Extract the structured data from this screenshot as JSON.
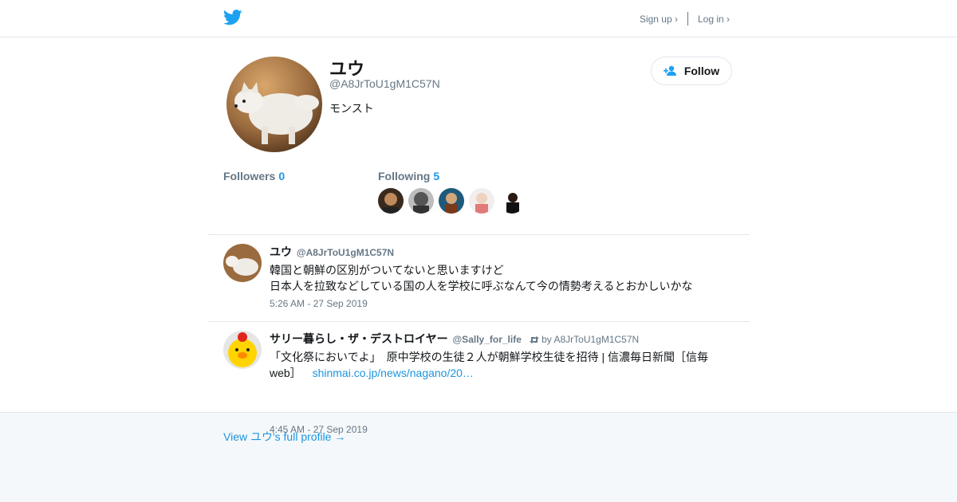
{
  "header": {
    "logo_icon": "twitter-bird-icon",
    "signup_label": "Sign up ›",
    "login_label": "Log in ›",
    "brand_color": "#1da1f2"
  },
  "profile": {
    "name": "ユウ",
    "handle": "@A8JrToU1gM1C57N",
    "bio": "モンスト",
    "follow_label": "Follow",
    "followers_label": "Followers",
    "followers_count": "0",
    "following_label": "Following",
    "following_count": "5"
  },
  "tweets": [
    {
      "name": "ユウ",
      "handle": "@A8JrToU1gM1C57N",
      "lines": [
        "韓国と朝鮮の区別がついてないと思いますけど",
        "日本人を拉致などしている国の人を学校に呼ぶなんて今の情勢考えるとおかしいかな"
      ],
      "time": "5:26 AM - 27 Sep 2019"
    },
    {
      "name": "サリー暮らし・ザ・デストロイヤー",
      "handle": "@Sally_for_life",
      "retweet_by": "by A8JrToU1gM1C57N",
      "text": "「文化祭においでよ」　原中学校の生徒２人が朝鮮学校生徒を招待 | 信濃毎日新聞［信毎web］",
      "link": "shinmai.co.jp/news/nagano/20…",
      "time": "4:45 AM - 27 Sep 2019"
    }
  ],
  "footer": {
    "full_profile_link": "View ユウ's full profile →"
  }
}
